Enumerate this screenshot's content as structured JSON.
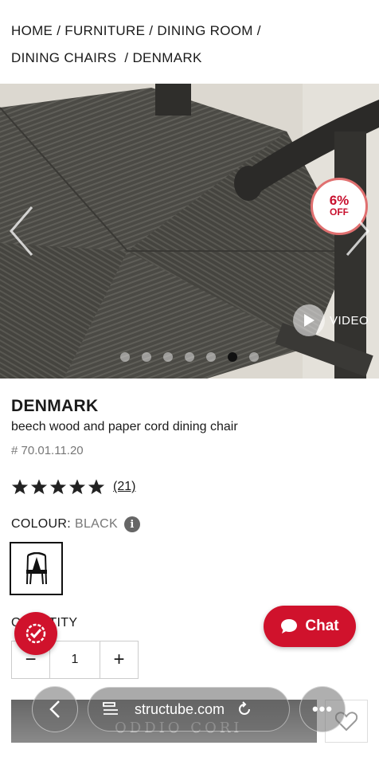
{
  "breadcrumb": {
    "items": [
      "HOME",
      "FURNITURE",
      "DINING ROOM",
      "DINING CHAIRS",
      "DENMARK"
    ],
    "separator": "/"
  },
  "gallery": {
    "discount_pct": "6%",
    "discount_off": "OFF",
    "video_label": "VIDEO",
    "slide_count": 7,
    "active_slide": 6
  },
  "product": {
    "name": "DENMARK",
    "description": "beech wood and paper cord dining chair",
    "sku": "# 70.01.11.20",
    "rating_stars": 5,
    "reviews": "(21)",
    "colour_label": "COLOUR:",
    "colour_value": "BLACK",
    "quantity_label": "QUANTITY",
    "quantity": "1",
    "minus": "−",
    "plus": "+"
  },
  "chat": {
    "label": "Chat"
  },
  "add_bar": {
    "ghost_text": "ODDIO CORI"
  },
  "browser": {
    "url": "structube.com"
  },
  "colors": {
    "brand_red": "#d0122c",
    "discount_border": "#e07070"
  }
}
